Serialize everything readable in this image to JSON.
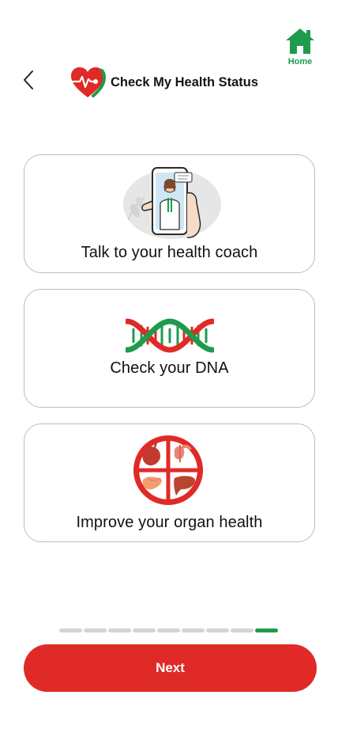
{
  "header": {
    "title": "Check My Health Status",
    "logo_icon": "heart-pulse-logo-icon",
    "back_icon": "chevron-left-icon"
  },
  "home": {
    "label": "Home",
    "icon": "home-icon"
  },
  "options": [
    {
      "label": "Talk to your health coach",
      "icon": "doctor-on-phone-icon"
    },
    {
      "label": "Check your DNA",
      "icon": "dna-helix-icon"
    },
    {
      "label": "Improve your organ health",
      "icon": "organs-icon"
    }
  ],
  "progress": {
    "total_steps": 9,
    "current_step": 9
  },
  "footer": {
    "next_label": "Next"
  },
  "colors": {
    "brand_green": "#1e9b4c",
    "brand_red": "#e02a27",
    "card_border": "#bdbdbd",
    "inactive_segment": "#d4d4d4"
  }
}
